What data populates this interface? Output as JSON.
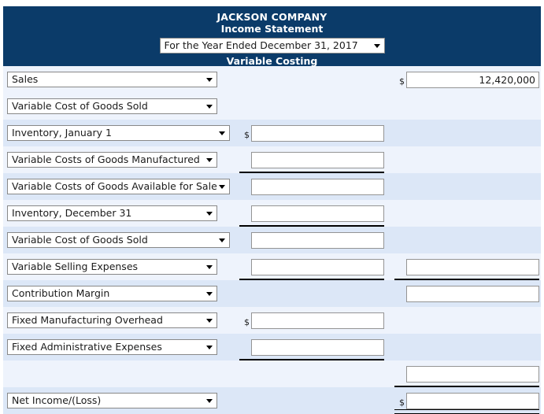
{
  "header": {
    "company_name": "JACKSON COMPANY",
    "statement_title": "Income Statement",
    "period_selected": "For the Year Ended December 31, 2017",
    "costing_method": "Variable Costing",
    "header_bg": "#0b3b69",
    "header_text_color": "#ffffff"
  },
  "symbols": {
    "dollar": "$"
  },
  "rows": [
    {
      "label": "Sales",
      "select_width": 267,
      "col1_value": "",
      "col1_dollar": false,
      "col1_visible": false,
      "col2_value": "12,420,000",
      "col2_dollar": true,
      "col2_visible": true,
      "rule": "none",
      "band": "a"
    },
    {
      "label": "Variable Cost of Goods Sold",
      "select_width": 267,
      "col1_value": "",
      "col1_dollar": false,
      "col1_visible": false,
      "col2_value": "",
      "col2_dollar": false,
      "col2_visible": false,
      "rule": "none",
      "band": "a"
    },
    {
      "label": "Inventory, January 1",
      "select_width": 283,
      "col1_value": "",
      "col1_dollar": true,
      "col1_visible": true,
      "col2_value": "",
      "col2_dollar": false,
      "col2_visible": false,
      "rule": "none",
      "band": "b"
    },
    {
      "label": "Variable Costs of Goods Manufactured",
      "select_width": 267,
      "col1_value": "",
      "col1_dollar": false,
      "col1_visible": true,
      "col2_value": "",
      "col2_dollar": false,
      "col2_visible": false,
      "rule": "col1",
      "band": "a"
    },
    {
      "label": "Variable Costs of Goods Available for Sale",
      "select_width": 283,
      "col1_value": "",
      "col1_dollar": false,
      "col1_visible": true,
      "col2_value": "",
      "col2_dollar": false,
      "col2_visible": false,
      "rule": "none",
      "band": "b"
    },
    {
      "label": "Inventory, December 31",
      "select_width": 267,
      "col1_value": "",
      "col1_dollar": false,
      "col1_visible": true,
      "col2_value": "",
      "col2_dollar": false,
      "col2_visible": false,
      "rule": "col1",
      "band": "a"
    },
    {
      "label": "Variable Cost of Goods Sold",
      "select_width": 283,
      "col1_value": "",
      "col1_dollar": false,
      "col1_visible": true,
      "col2_value": "",
      "col2_dollar": false,
      "col2_visible": false,
      "rule": "none",
      "band": "b"
    },
    {
      "label": "Variable Selling Expenses",
      "select_width": 267,
      "col1_value": "",
      "col1_dollar": false,
      "col1_visible": true,
      "col2_value": "",
      "col2_dollar": false,
      "col2_visible": true,
      "rule": "both",
      "band": "a"
    },
    {
      "label": "Contribution Margin",
      "select_width": 267,
      "col1_value": "",
      "col1_dollar": false,
      "col1_visible": false,
      "col2_value": "",
      "col2_dollar": false,
      "col2_visible": true,
      "rule": "none",
      "band": "b"
    },
    {
      "label": "Fixed Manufacturing Overhead",
      "select_width": 267,
      "col1_value": "",
      "col1_dollar": true,
      "col1_visible": true,
      "col2_value": "",
      "col2_dollar": false,
      "col2_visible": false,
      "rule": "none",
      "band": "a"
    },
    {
      "label": "Fixed Administrative Expenses",
      "select_width": 267,
      "col1_value": "",
      "col1_dollar": false,
      "col1_visible": true,
      "col2_value": "",
      "col2_dollar": false,
      "col2_visible": false,
      "rule": "col1",
      "band": "b"
    },
    {
      "label": "",
      "select_width": 0,
      "has_select": false,
      "col1_value": "",
      "col1_dollar": false,
      "col1_visible": false,
      "col2_value": "",
      "col2_dollar": false,
      "col2_visible": true,
      "rule": "col2",
      "band": "a"
    },
    {
      "label": "Net Income/(Loss)",
      "select_width": 267,
      "col1_value": "",
      "col1_dollar": false,
      "col1_visible": false,
      "col2_value": "",
      "col2_dollar": true,
      "col2_visible": true,
      "rule": "double",
      "band": "b"
    }
  ],
  "colors": {
    "band_a": "#eef3fc",
    "band_b": "#dce7f7",
    "input_border": "#949494",
    "rule_color": "#000000"
  }
}
